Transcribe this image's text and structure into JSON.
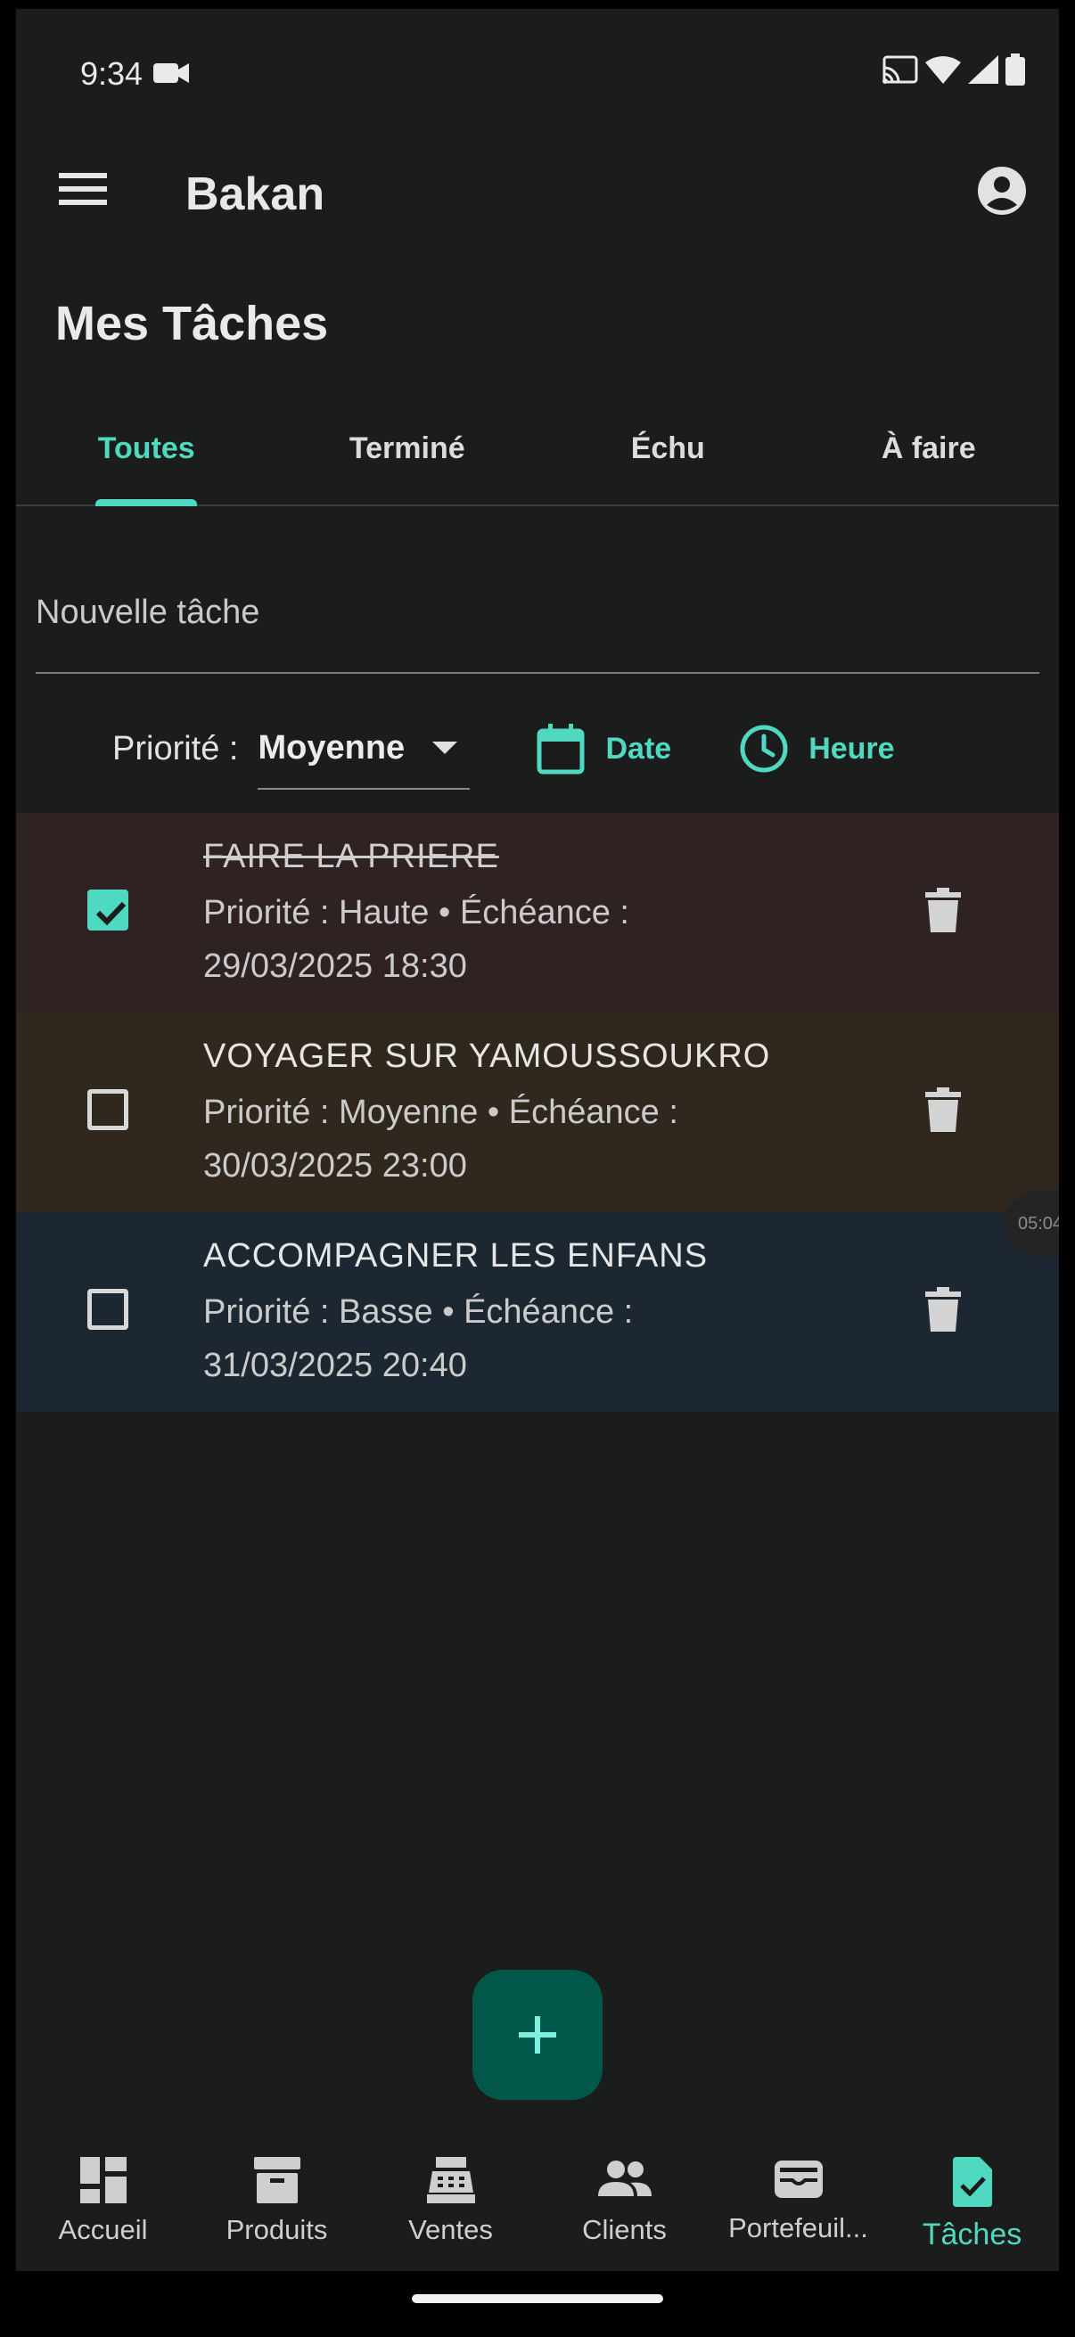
{
  "status_bar": {
    "time": "9:34"
  },
  "app_bar": {
    "title": "Bakan"
  },
  "page": {
    "title": "Mes Tâches"
  },
  "tabs": [
    {
      "label": "Toutes",
      "active": true
    },
    {
      "label": "Terminé",
      "active": false
    },
    {
      "label": "Échu",
      "active": false
    },
    {
      "label": "À faire",
      "active": false
    }
  ],
  "new_task": {
    "placeholder": "Nouvelle tâche",
    "value": ""
  },
  "priority": {
    "label": "Priorité :",
    "selected": "Moyenne",
    "date_label": "Date",
    "time_label": "Heure"
  },
  "tasks": [
    {
      "title": "FAIRE LA PRIERE",
      "meta_line1": "Priorité : Haute • Échéance :",
      "meta_line2": "29/03/2025 18:30",
      "done": true,
      "color": "#2f2222"
    },
    {
      "title": "VOYAGER SUR YAMOUSSOUKRO",
      "meta_line1": "Priorité : Moyenne • Échéance :",
      "meta_line2": "30/03/2025 23:00",
      "done": false,
      "color": "#30281f"
    },
    {
      "title": "ACCOMPAGNER LES ENFANS",
      "meta_line1": "Priorité : Basse • Échéance :",
      "meta_line2": "31/03/2025 20:40",
      "done": false,
      "color": "#1d2731"
    }
  ],
  "side_chip": "05:04",
  "fab": {
    "icon": "plus-icon"
  },
  "bottom_nav": [
    {
      "label": "Accueil",
      "icon": "dashboard-icon"
    },
    {
      "label": "Produits",
      "icon": "archive-box-icon"
    },
    {
      "label": "Ventes",
      "icon": "cash-register-icon"
    },
    {
      "label": "Clients",
      "icon": "people-icon"
    },
    {
      "label": "Portefeuil...",
      "icon": "wallet-icon"
    },
    {
      "label": "Tâches",
      "icon": "task-check-icon",
      "active": true
    }
  ],
  "colors": {
    "accent": "#4fd9c0",
    "background": "#1b1c1c",
    "fab": "#00574a"
  }
}
